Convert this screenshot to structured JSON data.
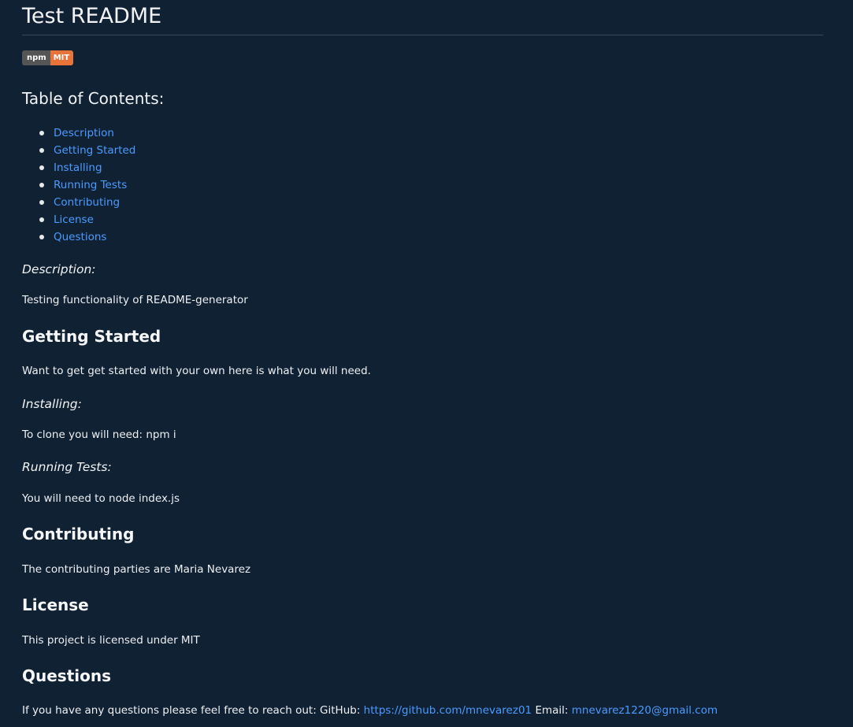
{
  "title": "Test README",
  "badge": {
    "left": "npm",
    "right": "MIT",
    "right_color": "#e8743b",
    "left_color": "#555555"
  },
  "toc": {
    "title": "Table of Contents:",
    "items": [
      "Description",
      "Getting Started",
      "Installing",
      "Running Tests",
      "Contributing",
      "License",
      "Questions"
    ]
  },
  "description": {
    "heading": "Description:",
    "text": "Testing functionality of README-generator"
  },
  "getting_started": {
    "heading": "Getting Started",
    "text": "Want to get get started with your own here is what you will need."
  },
  "installing": {
    "heading": "Installing:",
    "text": "To clone you will need: npm i"
  },
  "running_tests": {
    "heading": "Running Tests:",
    "text": "You will need to node index.js"
  },
  "contributing": {
    "heading": "Contributing",
    "text": "The contributing parties are Maria Nevarez"
  },
  "license": {
    "heading": "License",
    "text": "This project is licensed under MIT"
  },
  "questions": {
    "heading": "Questions",
    "text_prefix": "If you have any questions please feel free to reach out: GitHub:",
    "github_link": "https://github.com/mnevarez01",
    "email_label": "Email:",
    "email_link": "mnevarez1220@gmail.com"
  },
  "colors": {
    "background": "#112134",
    "link": "#4a9bff"
  }
}
